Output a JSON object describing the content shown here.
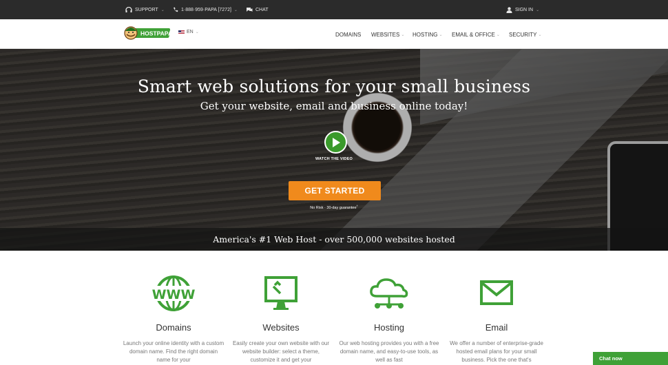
{
  "topbar": {
    "support": "SUPPORT",
    "phone": "1·888·959·PAPA [7272]",
    "chat": "CHAT",
    "sign_in": "SIGN IN",
    "support_icon": "headset-icon",
    "phone_icon": "phone-icon",
    "chat_icon": "chat-bubble-icon",
    "user_icon": "user-icon"
  },
  "nav": {
    "logo_text": "HOSTPAPA",
    "language": "EN",
    "items": [
      "DOMAINS",
      "WEBSITES",
      "HOSTING",
      "EMAIL & OFFICE",
      "SECURITY"
    ]
  },
  "hero": {
    "title": "Smart web solutions for your small business",
    "subtitle": "Get your website, email and business online today!",
    "watch_video": "WATCH THE VIDEO",
    "cta": "GET STARTED",
    "guarantee": "No Risk · 30-day guarantee",
    "guarantee_mark": "†",
    "band": "America's #1 Web Host - over 500,000 websites hosted"
  },
  "features": [
    {
      "icon": "www-globe-icon",
      "title": "Domains",
      "desc": "Launch your online identity with a custom domain name. Find the right domain name for your"
    },
    {
      "icon": "monitor-builder-icon",
      "title": "Websites",
      "desc": "Easily create your own website with our website builder: select a theme, customize it and get your"
    },
    {
      "icon": "cloud-hosting-icon",
      "title": "Hosting",
      "desc": "Our web hosting provides you with a free domain name, and easy-to-use tools, as well as fast"
    },
    {
      "icon": "envelope-icon",
      "title": "Email",
      "desc": "We offer a number of enterprise-grade hosted email plans for your small business. Pick the one that's"
    }
  ],
  "chat_widget": "Chat now",
  "colors": {
    "brand_green": "#3fa137",
    "cta_orange": "#f08a1c",
    "topbar": "#2b2b2b"
  }
}
